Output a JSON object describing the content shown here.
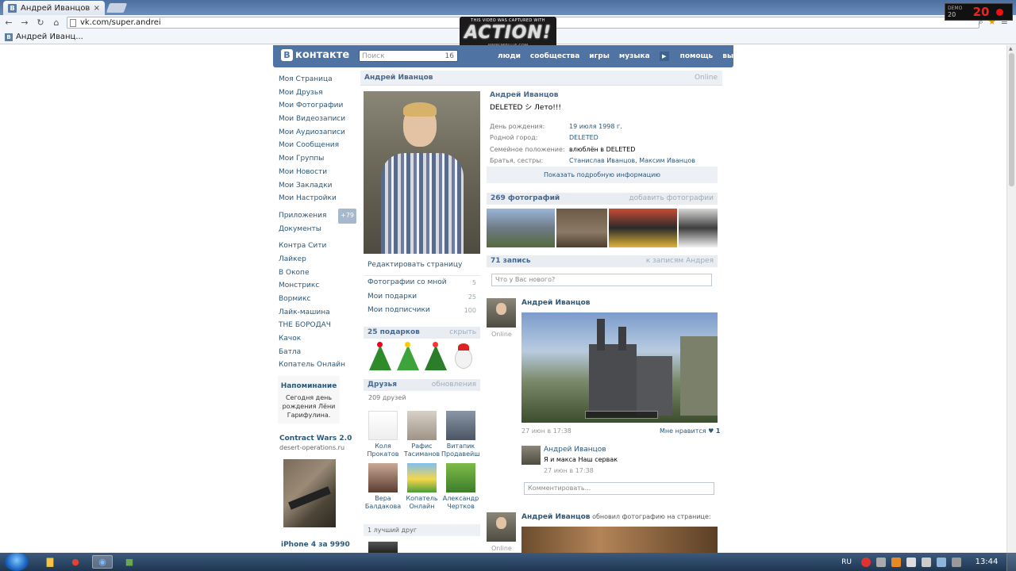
{
  "browser": {
    "tab_title": "Андрей Иванцов",
    "tab_favicon": "В",
    "url": "vk.com/super.andrei",
    "bookmark": "Андрей Иванц..."
  },
  "overlay": {
    "watermark_top": "THIS VIDEO WAS CAPTURED WITH",
    "watermark_logo": "ACTION!",
    "watermark_url": "WWW.MIRILLIS.COM",
    "fps_label": "DEMO",
    "fps_small": "20",
    "fps_value": "20"
  },
  "vk_header": {
    "logo": "контакте",
    "logo_letter": "В",
    "search_placeholder": "Поиск",
    "search_count": "16",
    "menu": [
      "люди",
      "сообщества",
      "игры",
      "музыка",
      "помощь",
      "выйти"
    ]
  },
  "left_menu": {
    "main": [
      "Моя Страница",
      "Мои Друзья",
      "Мои Фотографии",
      "Мои Видеозаписи",
      "Мои Аудиозаписи",
      "Мои Сообщения",
      "Мои Группы",
      "Мои Новости",
      "Мои Закладки",
      "Мои Настройки"
    ],
    "apps_label": "Приложения",
    "apps_badge": "+79",
    "docs": "Документы",
    "games": [
      "Контра Сити",
      "Лайкер",
      "В Окопе",
      "Монстрикс",
      "Вормикс",
      "Лайк-машина",
      "THE БОРОДАЧ",
      "Качок",
      "Батла",
      "Копатель Онлайн"
    ]
  },
  "reminder": {
    "title": "Напоминание",
    "text_line1": "Сегодня день",
    "text_line2": "рождения Лёни",
    "text_line3": "Гарифулина."
  },
  "ads": {
    "ad1_title": "Contract Wars 2.0",
    "ad1_domain": "desert-operations.ru",
    "ad2_title": "iPhone 4 за 9990"
  },
  "profile": {
    "name": "Андрей Иванцов",
    "online": "Online",
    "status": "DELETED シ Лето!!!",
    "edit_page": "Редактировать страницу",
    "stats": [
      {
        "label": "Фотографии со мной",
        "count": "5"
      },
      {
        "label": "Мои подарки",
        "count": "25"
      },
      {
        "label": "Мои подписчики",
        "count": "100"
      }
    ],
    "info": [
      {
        "key": "День рождения:",
        "value": "19 июля 1998 г."
      },
      {
        "key": "Родной город:",
        "value": "DELETED"
      },
      {
        "key": "Семейное положение:",
        "value": "влюблён в DELETED"
      },
      {
        "key": "Братья, сестры:",
        "value": "Станислав Иванцов, Максим Иванцов"
      }
    ],
    "more_info": "Показать подробную информацию"
  },
  "gifts": {
    "title": "25 подарков",
    "action": "скрыть"
  },
  "friends": {
    "title": "Друзья",
    "action": "обновления",
    "count": "209 друзей",
    "list": [
      {
        "first": "Коля",
        "last": "Прокатов"
      },
      {
        "first": "Рафис",
        "last": "Тасиманов"
      },
      {
        "first": "Витапик",
        "last": "Продавейшен"
      },
      {
        "first": "Вера",
        "last": "Балдакова"
      },
      {
        "first": "Копатель",
        "last": "Онлайн"
      },
      {
        "first": "Александр",
        "last": "Чертков"
      }
    ],
    "best_friend": "1 лучший друг"
  },
  "photos": {
    "title": "269 фотографий",
    "action": "добавить фотографии"
  },
  "wall": {
    "title": "71 запись",
    "action": "к записям Андрея",
    "input_placeholder": "Что у Вас нового?",
    "post1": {
      "author": "Андрей Иванцов",
      "online": "Online",
      "date": "27 июн в 17:38",
      "likes_label": "Мне нравится",
      "likes": "1"
    },
    "comment": {
      "author": "Андрей Иванцов",
      "text": "Я и макса Наш сервак",
      "date": "27 июн в 17:38"
    },
    "comment_placeholder": "Комментировать...",
    "post2": {
      "author": "Андрей Иванцов",
      "action": "обновил фотографию на странице:",
      "online": "Online"
    }
  },
  "taskbar": {
    "lang": "RU",
    "time": "13:44"
  }
}
